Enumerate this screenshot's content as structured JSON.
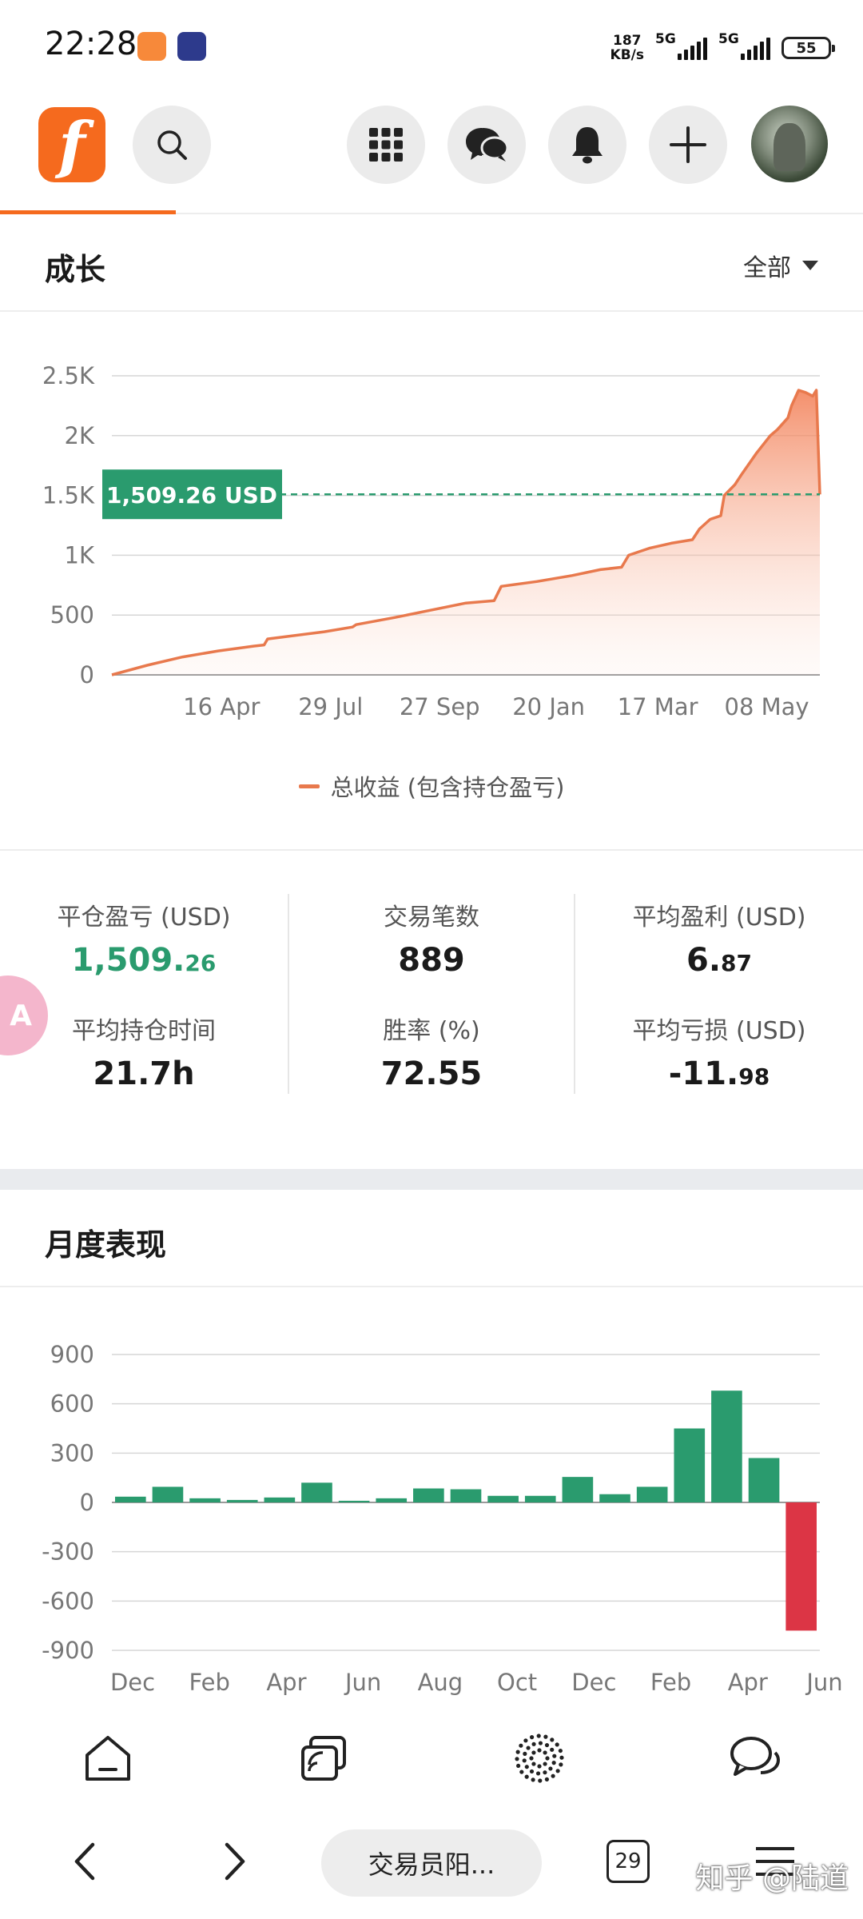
{
  "status_bar": {
    "time": "22:28",
    "net_speed_value": "187",
    "net_speed_unit": "KB/s",
    "signal1_label": "5G",
    "signal2_label": "5G",
    "battery": "55"
  },
  "top_nav": {
    "logo_letter": "f",
    "icons": [
      "search-icon",
      "apps-grid-icon",
      "chat-icon",
      "bell-icon",
      "plus-icon",
      "avatar"
    ],
    "accent_color": "#f56a1e"
  },
  "growth": {
    "title": "成长",
    "filter_label": "全部",
    "legend": "总收益 (包含持仓盈亏)",
    "current_value_label": "1,509.26 USD"
  },
  "stats": {
    "closed_pnl_label": "平仓盈亏 (USD)",
    "closed_pnl_int": "1,509.",
    "closed_pnl_dec": "26",
    "trades_label": "交易笔数",
    "trades_value": "889",
    "avg_profit_label": "平均盈利 (USD)",
    "avg_profit_int": "6.",
    "avg_profit_dec": "87",
    "avg_hold_label": "平均持仓时间",
    "avg_hold_value": "21.7h",
    "win_rate_label": "胜率 (%)",
    "win_rate_value": "72.55",
    "avg_loss_label": "平均亏损 (USD)",
    "avg_loss_int": "-11.",
    "avg_loss_dec": "98",
    "bubble_text": "A"
  },
  "monthly": {
    "title": "月度表现"
  },
  "bottom_tabs": [
    "home-icon",
    "feed-icon",
    "discover-icon",
    "messages-icon"
  ],
  "browser": {
    "url_title": "交易员阳...",
    "tab_count": "29",
    "watermark": "知乎 @陆道"
  },
  "chart_data": [
    {
      "type": "area",
      "title": "",
      "xlabel": "",
      "ylabel": "",
      "x_tick_labels": [
        "16 Apr",
        "29 Jul",
        "27 Sep",
        "20 Jan",
        "17 Mar",
        "08 May"
      ],
      "y_tick_labels": [
        "0",
        "500",
        "1K",
        "1.5K",
        "2K",
        "2.5K"
      ],
      "ylim": [
        0,
        2500
      ],
      "grid": true,
      "series": [
        {
          "name": "总收益 (包含持仓盈亏)",
          "color": "#e8794d",
          "x": [
            0,
            0.05,
            0.1,
            0.15,
            0.2,
            0.215,
            0.22,
            0.3,
            0.34,
            0.345,
            0.4,
            0.45,
            0.5,
            0.54,
            0.55,
            0.6,
            0.65,
            0.69,
            0.72,
            0.73,
            0.76,
            0.79,
            0.82,
            0.83,
            0.845,
            0.86,
            0.865,
            0.88,
            0.89,
            0.91,
            0.93,
            0.94,
            0.955,
            0.96,
            0.97,
            0.98,
            0.99,
            0.995,
            1.0
          ],
          "y": [
            0,
            80,
            150,
            200,
            240,
            250,
            300,
            360,
            400,
            420,
            480,
            540,
            600,
            620,
            740,
            780,
            830,
            880,
            900,
            1000,
            1060,
            1100,
            1130,
            1220,
            1300,
            1330,
            1500,
            1590,
            1680,
            1850,
            2000,
            2050,
            2150,
            2250,
            2380,
            2360,
            2330,
            2380,
            1509
          ]
        }
      ],
      "reference_line": {
        "value": 1509.26,
        "label": "1,509.26 USD",
        "color": "#2a9b6e"
      }
    },
    {
      "type": "bar",
      "title": "",
      "xlabel": "",
      "ylabel": "",
      "x_tick_labels": [
        "Dec",
        "Feb",
        "Apr",
        "Jun",
        "Aug",
        "Oct",
        "Dec",
        "Feb",
        "Apr",
        "Jun"
      ],
      "y_tick_labels": [
        "900",
        "600",
        "300",
        "0",
        "-300",
        "-600",
        "-900"
      ],
      "ylim": [
        -900,
        900
      ],
      "grid": true,
      "positive_color": "#2a9b6e",
      "negative_color": "#dc3545",
      "values": [
        35,
        95,
        25,
        15,
        30,
        120,
        10,
        25,
        85,
        80,
        40,
        40,
        155,
        50,
        95,
        450,
        680,
        270,
        -780
      ]
    }
  ]
}
